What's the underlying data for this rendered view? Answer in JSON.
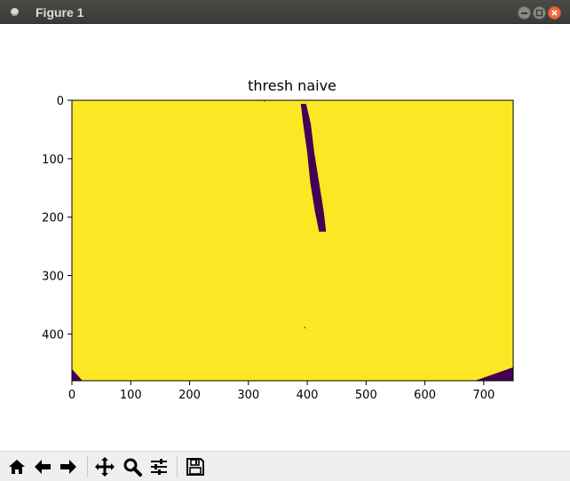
{
  "window": {
    "title": "Figure 1"
  },
  "plot": {
    "title": "thresh naive",
    "colors": {
      "foreground": "#fde725",
      "background": "#440154"
    }
  },
  "chart_data": {
    "type": "heatmap",
    "title": "thresh naive",
    "xlim": [
      0,
      750
    ],
    "ylim": [
      480,
      0
    ],
    "x_ticks": [
      "0",
      "100",
      "200",
      "300",
      "400",
      "500",
      "600",
      "700"
    ],
    "y_ticks": [
      "0",
      "100",
      "200",
      "300",
      "400"
    ],
    "colormap": "viridis",
    "values_description_levels": [
      0,
      1
    ],
    "regions": [
      {
        "label": "stroke",
        "value": 0,
        "points": [
          [
            389,
            6
          ],
          [
            398,
            6
          ],
          [
            406,
            40
          ],
          [
            412,
            90
          ],
          [
            420,
            140
          ],
          [
            428,
            190
          ],
          [
            432,
            225
          ],
          [
            420,
            225
          ],
          [
            413,
            190
          ],
          [
            405,
            140
          ],
          [
            400,
            90
          ],
          [
            393,
            40
          ]
        ]
      },
      {
        "label": "bottom-left corner",
        "value": 0,
        "points": [
          [
            0,
            460
          ],
          [
            18,
            480
          ],
          [
            0,
            480
          ]
        ]
      },
      {
        "label": "bottom-right corner",
        "value": 0,
        "points": [
          [
            685,
            480
          ],
          [
            750,
            457
          ],
          [
            750,
            480
          ]
        ]
      },
      {
        "label": "top speck",
        "value": 0,
        "points": [
          [
            326,
            0
          ],
          [
            328,
            0
          ],
          [
            328,
            2
          ],
          [
            326,
            2
          ]
        ]
      },
      {
        "label": "speck",
        "value": 0,
        "points": [
          [
            395,
            388
          ],
          [
            397,
            388
          ],
          [
            397,
            390
          ],
          [
            395,
            390
          ]
        ]
      }
    ]
  },
  "toolbar": {
    "buttons": [
      {
        "name": "home-button",
        "icon": "home-icon"
      },
      {
        "name": "back-button",
        "icon": "arrow-left-icon"
      },
      {
        "name": "forward-button",
        "icon": "arrow-right-icon"
      },
      {
        "name": "pan-button",
        "icon": "move-icon"
      },
      {
        "name": "zoom-button",
        "icon": "magnifier-icon"
      },
      {
        "name": "configure-subplots-button",
        "icon": "sliders-icon"
      },
      {
        "name": "save-button",
        "icon": "floppy-disk-icon"
      }
    ]
  }
}
